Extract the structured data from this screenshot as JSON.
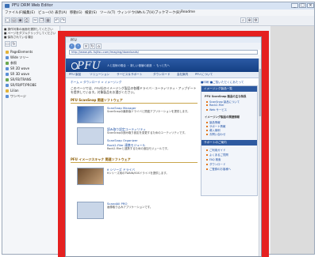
{
  "window": {
    "title": "PFU DRM Web Editor",
    "controls": [
      "_",
      "□",
      "×"
    ]
  },
  "menubar": [
    "ファイル(F)",
    "編集(E)",
    "ビュー(V)",
    "表示(A)",
    "移動(G)",
    "検索(S)",
    "ツール(T)",
    "ウィンドウ(W)",
    "ヘルプ(H)",
    "ブックマーク(B)",
    "Readme"
  ],
  "toolbar": {
    "icons": [
      "new-icon",
      "open-icon",
      "save-icon",
      "print-icon",
      "cut-icon",
      "copy-icon",
      "paste-icon",
      "undo-icon",
      "redo-icon",
      "search-icon",
      "zoom-icon",
      "settings-icon"
    ]
  },
  "sidepanel": {
    "hints": [
      "■ 操作対象の画面を選択してください",
      "■ ページをダブルクリックしてください",
      "■ 保存されている項目"
    ],
    "tree": [
      "PageElements",
      "Wide ツリー",
      "参照",
      "SR 2D wave",
      "SR 3D wave",
      "SR/FB/TRANS",
      "SR/FB/PT/PROBE",
      "Lilian",
      "ワンページ"
    ]
  },
  "browser": {
    "title": "PFU",
    "address": "http://www.pfu.fujitsu.com/imaging/downloads/",
    "logo": "PFU",
    "tagline": "人と技術の融合 ・ 新しい価値の創造 ・ もっと先へ",
    "topnav": [
      "PFU 製品",
      "ソリューション",
      "サービス＆サポート",
      "ダウンロード",
      "会社案内",
      "PFU について"
    ],
    "crumb": "ホーム > ダウンロード > イメージング",
    "rightlinks": "■印刷  ■ご覧いただくにあたって",
    "lead": "このページでは、PFU社のイメージング製品の各種ドライバ・ユーティリティ・アップデートを提供しています。対象製品をお選びください。",
    "sections": [
      {
        "title": "PFU ScanSnap 関連ソフトウェア",
        "items": [
          {
            "h": "ScanSnap Manager",
            "b": "ScanSnapの最新版ドライバと関連アプリケーションを提供します。"
          },
          {
            "h": "読み取り設定ユーティリティ",
            "b": "ScanSnapの読み取り設定を変更するためのユーティリティです。"
          },
          {
            "h": "ScanSnap Organizer",
            "b": "スキャンした文書を整理・管理するソフトウェアです。"
          },
          {
            "h": "Rack2-Filer 連携モジュール",
            "b": "Rack2-Filerと連携するための追加モジュールです。"
          }
        ]
      },
      {
        "title": "PFU イメージスキャナ 関連ソフトウェア",
        "items": [
          {
            "h": "fi シリーズ ドライバ",
            "b": "fiシリーズ用のTWAIN/ISISドライバを提供します。"
          },
          {
            "h": "ScandAll PRO",
            "b": "画像取り込みアプリケーションです。"
          }
        ]
      }
    ],
    "sidebox": {
      "head1": "イメージング製品一覧",
      "text1": "PFU ScanSnap 製品の主な特長",
      "links1": [
        "ScanSnap 製品について",
        "Rack2-Filer",
        "Web サービス"
      ],
      "text2": "イメージング製品の関連情報",
      "links2": [
        "製品情報",
        "サポート情報",
        "導入事例",
        "お問い合わせ"
      ],
      "head2": "サポートのご案内",
      "links3": [
        "ご利用ガイド",
        "よくあるご質問",
        "FAQ 検索",
        "ダウンロード",
        "ご登録のお客様へ"
      ]
    }
  },
  "colors": {
    "frame": "#e52020",
    "header": "#1f4c95",
    "link": "#1d4fa3"
  }
}
